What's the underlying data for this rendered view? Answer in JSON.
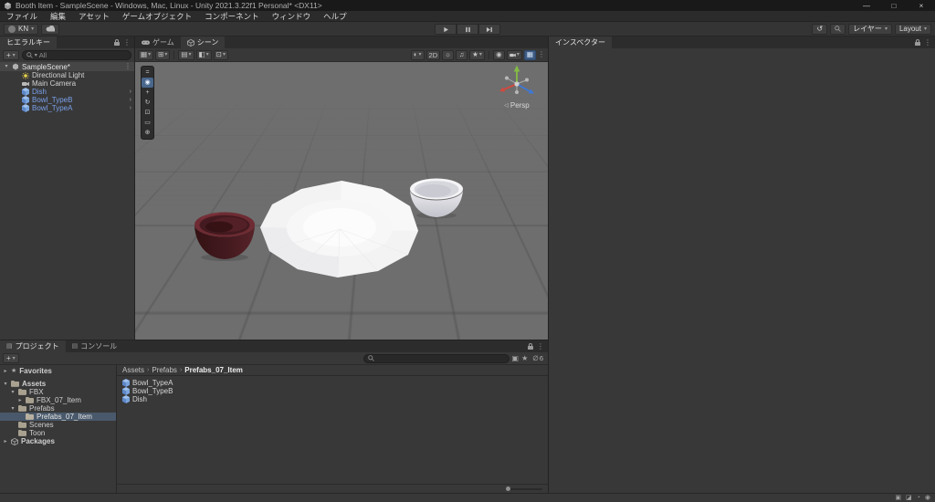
{
  "window": {
    "title": "Booth Item - SampleScene - Windows, Mac, Linux - Unity 2021.3.22f1 Personal* <DX11>"
  },
  "menu": {
    "items": [
      "ファイル",
      "編集",
      "アセット",
      "ゲームオブジェクト",
      "コンポーネント",
      "ウィンドウ",
      "ヘルプ"
    ]
  },
  "toolbar": {
    "account_label": "KN",
    "layers_label": "レイヤー",
    "layout_label": "Layout"
  },
  "hierarchy": {
    "tab_label": "ヒエラルキー",
    "add_button_label": "+",
    "search_scope": "All",
    "scene_name": "SampleScene*",
    "items": [
      {
        "name": "Directional Light"
      },
      {
        "name": "Main Camera"
      },
      {
        "name": "Dish"
      },
      {
        "name": "Bowl_TypeB"
      },
      {
        "name": "Bowl_TypeA"
      }
    ]
  },
  "scene_view": {
    "game_tab_label": "ゲーム",
    "scene_tab_label": "シーン",
    "mode_2d_label": "2D",
    "gizmo_label": "Persp"
  },
  "inspector": {
    "tab_label": "インスペクター"
  },
  "project": {
    "project_tab_label": "プロジェクト",
    "console_tab_label": "コンソール",
    "add_button_label": "+",
    "hidden_count": "6",
    "breadcrumb": {
      "root": "Assets",
      "mid": "Prefabs",
      "leaf": "Prefabs_07_Item"
    },
    "tree": [
      {
        "label": "Favorites"
      },
      {
        "label": "Assets"
      },
      {
        "label": "FBX"
      },
      {
        "label": "FBX_07_Item"
      },
      {
        "label": "Prefabs"
      },
      {
        "label": "Prefabs_07_Item"
      },
      {
        "label": "Scenes"
      },
      {
        "label": "Toon"
      },
      {
        "label": "Packages"
      }
    ],
    "files": [
      {
        "label": "Bowl_TypeA"
      },
      {
        "label": "Bowl_TypeB"
      },
      {
        "label": "Dish"
      }
    ]
  },
  "colors": {
    "prefab_text": "#7AA0EA",
    "selection": "#49596B",
    "scene_background": "#6E6E6E",
    "plate": "#F3F3F4",
    "bowl_red": "#451A1F",
    "bowl_white": "#ECECF0",
    "axis_x": "#D1493E",
    "axis_y": "#84BC44",
    "axis_z": "#3C78D8"
  }
}
